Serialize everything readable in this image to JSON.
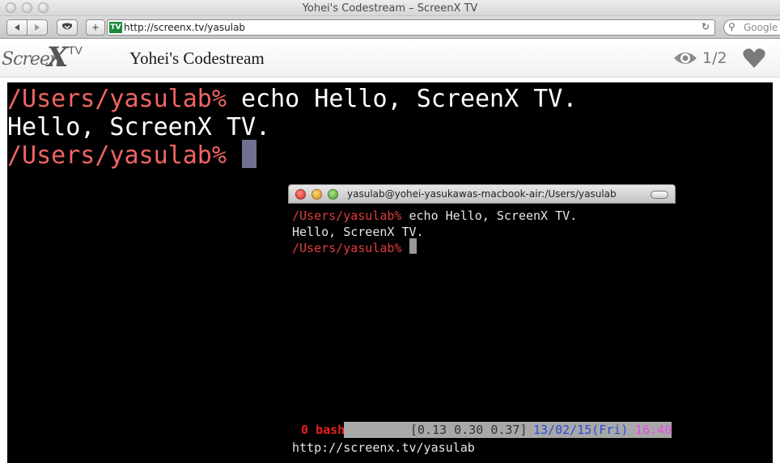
{
  "browser": {
    "window_title": "Yohei's Codestream – ScreenX TV",
    "back_icon": "back-arrow-icon",
    "forward_icon": "forward-arrow-icon",
    "url": "http://screenx.tv/yasulab",
    "favicon_text": "TV",
    "search_placeholder": "Google",
    "add_symbol": "+"
  },
  "site": {
    "logo_text_screen": "Screen",
    "logo_text_x": "X",
    "logo_text_tv": "TV",
    "stream_title": "Yohei's Codestream",
    "viewer_count": "1/2",
    "colors": {
      "header_bg": "#f4f4f4",
      "icon_gray": "#7a7a7a"
    }
  },
  "terminal": {
    "lines": [
      {
        "prompt": "/Users/yasulab%",
        "command": " echo Hello, ScreenX TV."
      },
      {
        "prompt": "",
        "command": "Hello, ScreenX TV."
      },
      {
        "prompt": "/Users/yasulab%",
        "command": " "
      }
    ],
    "colors": {
      "background": "#000000",
      "prompt": "#f06464",
      "text": "#ffffff",
      "cursor": "#707090"
    }
  },
  "inner_terminal": {
    "title": "yasulab@yohei-yasukawas-macbook-air:/Users/yasulab",
    "lines": [
      {
        "prompt": "/Users/yasulab%",
        "command": " echo Hello, ScreenX TV."
      },
      {
        "prompt": "",
        "command": "Hello, ScreenX TV."
      },
      {
        "prompt": "/Users/yasulab%",
        "command": " "
      }
    ],
    "status_bar": {
      "window": " 0 bash",
      "load": "[0.13 0.30 0.37]",
      "date": "13/02/15(Fri)",
      "time": "16:40"
    },
    "footer_url": "http://screenx.tv/yasulab"
  }
}
